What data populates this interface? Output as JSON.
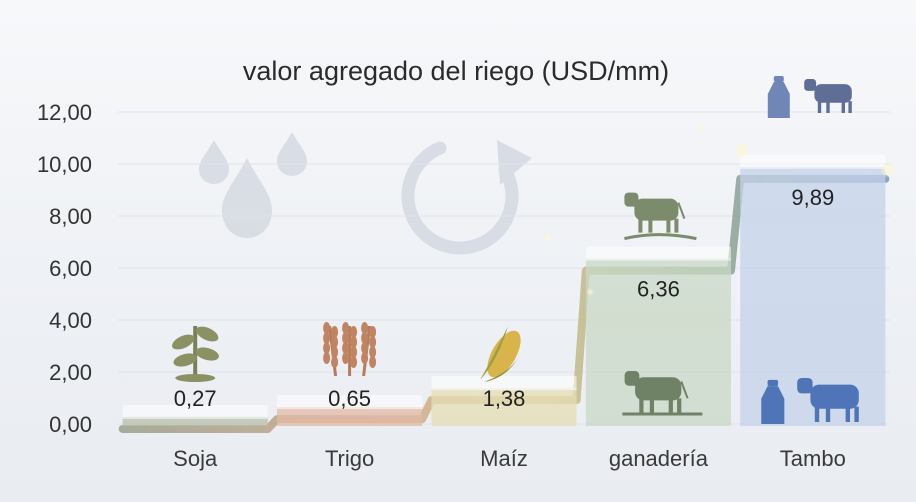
{
  "chart_data": {
    "type": "bar",
    "title": "valor agregado del riego (USD/mm)",
    "categories": [
      "Soja",
      "Trigo",
      "Maíz",
      "ganadería",
      "Tambo"
    ],
    "values": [
      0.27,
      0.65,
      1.38,
      6.36,
      9.89
    ],
    "value_labels": [
      "0,27",
      "0,65",
      "1,38",
      "6,36",
      "9,89"
    ],
    "ylim": [
      0,
      12
    ],
    "yticks": [
      0,
      2,
      4,
      6,
      8,
      10,
      12
    ],
    "ytick_labels": [
      "0,00",
      "2,00",
      "4,00",
      "6,00",
      "8,00",
      "10,00",
      "12,00"
    ],
    "xlabel": "",
    "ylabel": "",
    "grid": true,
    "legend": "none",
    "colors": [
      "#b8bfa9",
      "#e3b9a6",
      "#e6ddb4",
      "#c9d8c6",
      "#c4d2ea"
    ],
    "icons": [
      "sprout-icon",
      "wheat-icon",
      "corn-icon",
      "cow-icon",
      "milk-cow-icon"
    ],
    "background_icons": [
      "water-drops-icon",
      "cycle-arrow-icon"
    ]
  }
}
